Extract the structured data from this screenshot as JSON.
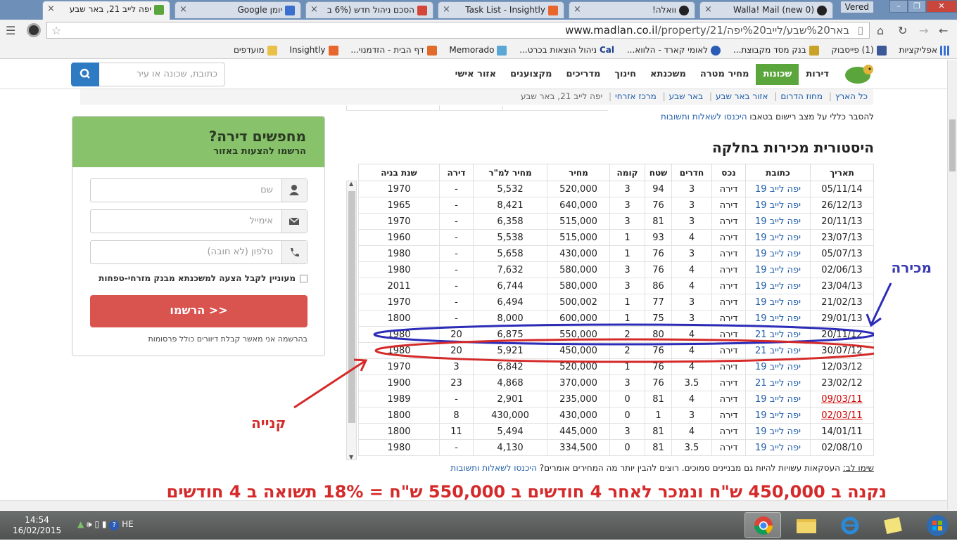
{
  "browser": {
    "tabs": [
      {
        "title": "יפה לייב 21, באר שבע",
        "active": true
      },
      {
        "title": "יומן Google"
      },
      {
        "title": "הסכם ניהול חדש (6% ב"
      },
      {
        "title": "Task List - Insightly"
      },
      {
        "title": "וואלה!"
      },
      {
        "title": "(0 new) Walla! Mail"
      }
    ],
    "user": "Vered",
    "url_host": "www.madlan.co.il",
    "url_path": "/property/21/באר%20שבע/לייב%20יפה",
    "bookmarks": [
      "אפליקציות",
      "(1) פייסבוק",
      "בנק מסד מקבוצת...",
      "לאומי קארד - הלווא...",
      "ניהול הוצאות בכרט...",
      "Memorado",
      "דף הבית - הזדמנוי...",
      "Insightly",
      "מועדפים"
    ],
    "bookmarks_cal": "Cal"
  },
  "site": {
    "nav": [
      "דירות",
      "שכונות",
      "מחיר מטרה",
      "משכנתא",
      "חינוך",
      "מדריכים",
      "מקצוענים",
      "אזור אישי"
    ],
    "search_placeholder": "כתובת, שכונה או עיר"
  },
  "breadcrumb": [
    "כל הארץ",
    "מחוז הדרום",
    "אזור באר שבע",
    "באר שבע",
    "מרכז אזרחי",
    "יפה לייב 21, באר שבע"
  ],
  "registry_note": "להסבר כללי על מצב רישום בטאבו",
  "registry_link": "היכנסו לשאלות ותשובות",
  "section_title": "היסטורית מכירות בחלקה",
  "table": {
    "headers": [
      "תאריך",
      "כתובת",
      "נכס",
      "חדרים",
      "שטח",
      "קומה",
      "מחיר",
      "מחיר למ\"ר",
      "דירה",
      "שנת בניה"
    ],
    "rows": [
      [
        "05/11/14",
        "יפה לייב 19",
        "דירה",
        "3",
        "94",
        "3",
        "520,000",
        "5,532",
        "-",
        "1970"
      ],
      [
        "26/12/13",
        "יפה לייב 19",
        "דירה",
        "3",
        "76",
        "3",
        "640,000",
        "8,421",
        "-",
        "1965"
      ],
      [
        "20/11/13",
        "יפה לייב 19",
        "דירה",
        "3",
        "81",
        "3",
        "515,000",
        "6,358",
        "-",
        "1970"
      ],
      [
        "23/07/13",
        "יפה לייב 19",
        "דירה",
        "4",
        "93",
        "1",
        "515,000",
        "5,538",
        "-",
        "1960"
      ],
      [
        "05/07/13",
        "יפה לייב 19",
        "דירה",
        "3",
        "76",
        "1",
        "430,000",
        "5,658",
        "-",
        "1980"
      ],
      [
        "02/06/13",
        "יפה לייב 19",
        "דירה",
        "4",
        "76",
        "3",
        "580,000",
        "7,632",
        "-",
        "1980"
      ],
      [
        "23/04/13",
        "יפה לייב 19",
        "דירה",
        "4",
        "86",
        "3",
        "580,000",
        "6,744",
        "-",
        "2011"
      ],
      [
        "21/02/13",
        "יפה לייב 19",
        "דירה",
        "3",
        "77",
        "1",
        "500,002",
        "6,494",
        "-",
        "1970"
      ],
      [
        "29/01/13",
        "יפה לייב 19",
        "דירה",
        "3",
        "75",
        "1",
        "600,000",
        "8,000",
        "-",
        "1800"
      ],
      [
        "20/11/12",
        "יפה לייב 21",
        "דירה",
        "4",
        "80",
        "2",
        "550,000",
        "6,875",
        "20",
        "1980"
      ],
      [
        "30/07/12",
        "יפה לייב 21",
        "דירה",
        "4",
        "76",
        "2",
        "450,000",
        "5,921",
        "20",
        "1980"
      ],
      [
        "12/03/12",
        "יפה לייב 19",
        "דירה",
        "4",
        "76",
        "1",
        "520,000",
        "6,842",
        "3",
        "1970"
      ],
      [
        "23/02/12",
        "יפה לייב 21",
        "דירה",
        "3.5",
        "76",
        "3",
        "370,000",
        "4,868",
        "23",
        "1900"
      ],
      [
        "09/03/11",
        "יפה לייב 19",
        "דירה",
        "4",
        "81",
        "0",
        "235,000",
        "2,901",
        "-",
        "1989"
      ],
      [
        "02/03/11",
        "יפה לייב 19",
        "דירה",
        "3",
        "1",
        "0",
        "430,000",
        "430,000",
        "8",
        "1800"
      ],
      [
        "14/01/11",
        "יפה לייב 19",
        "דירה",
        "4",
        "81",
        "3",
        "445,000",
        "5,494",
        "11",
        "1800"
      ],
      [
        "02/08/10",
        "יפה לייב 19",
        "דירה",
        "3.5",
        "81",
        "0",
        "334,500",
        "4,130",
        "-",
        "1980"
      ]
    ]
  },
  "note_label": "שימו לב:",
  "note_text": "העסקאות עשויות להיות גם מבניינים סמוכים. רוצים להבין יותר מה המחירים אומרים?",
  "note_link": "היכנסו לשאלות ותשובות",
  "form": {
    "title": "מחפשים דירה?",
    "subtitle": "הרשמו להצעות באזור",
    "name_placeholder": "שם",
    "email_placeholder": "אימייל",
    "phone_placeholder": "טלפון (לא חובה)",
    "checkbox_label": "מעוניין לקבל הצעה למשכנתא מבנק מזרחי-טפחות",
    "submit": "הרשמו >>",
    "fine_print": "בהרשמה אני מאשר קבלת דיוורים כולל פרסומות"
  },
  "annotations": {
    "sale": "מכירה",
    "purchase": "קנייה",
    "summary": "נקנה ב 450,000 ש\"ח ונמכר לאחר 4 חודשים ב 550,000 ש\"ח = 18% תשואה ב 4 חודשים"
  },
  "taskbar": {
    "time": "14:54",
    "date": "16/02/2015",
    "lang": "HE"
  },
  "colors": {
    "brand_green": "#5ba53d",
    "sale_ellipse": "#2c2cb8",
    "purchase_ellipse": "#d52a2a",
    "link": "#1e5ca8"
  }
}
